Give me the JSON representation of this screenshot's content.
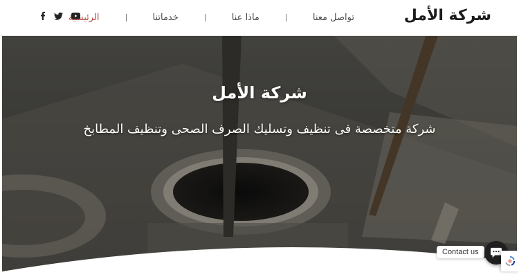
{
  "header": {
    "brand": "شركة الأمل",
    "nav": [
      {
        "label": "الرئيسية",
        "active": true
      },
      {
        "label": "خدماتنا",
        "active": false
      },
      {
        "label": "ماذا عنا",
        "active": false
      },
      {
        "label": "تواصل معنا",
        "active": false
      }
    ],
    "social_icons": [
      "facebook-icon",
      "twitter-icon",
      "youtube-icon"
    ]
  },
  "hero": {
    "title": "شركة الأمل",
    "subtitle": "شركة متخصصة فى تنظيف وتسليك الصرف الصحى وتنظيف المطابخ",
    "background_description": "sewer-manhole-photo"
  },
  "contact_widget": {
    "label": "Contact us",
    "icon": "chat-icon"
  },
  "colors": {
    "accent": "#b3473c",
    "text": "#4a4a4a",
    "header_bg": "#ffffff"
  }
}
